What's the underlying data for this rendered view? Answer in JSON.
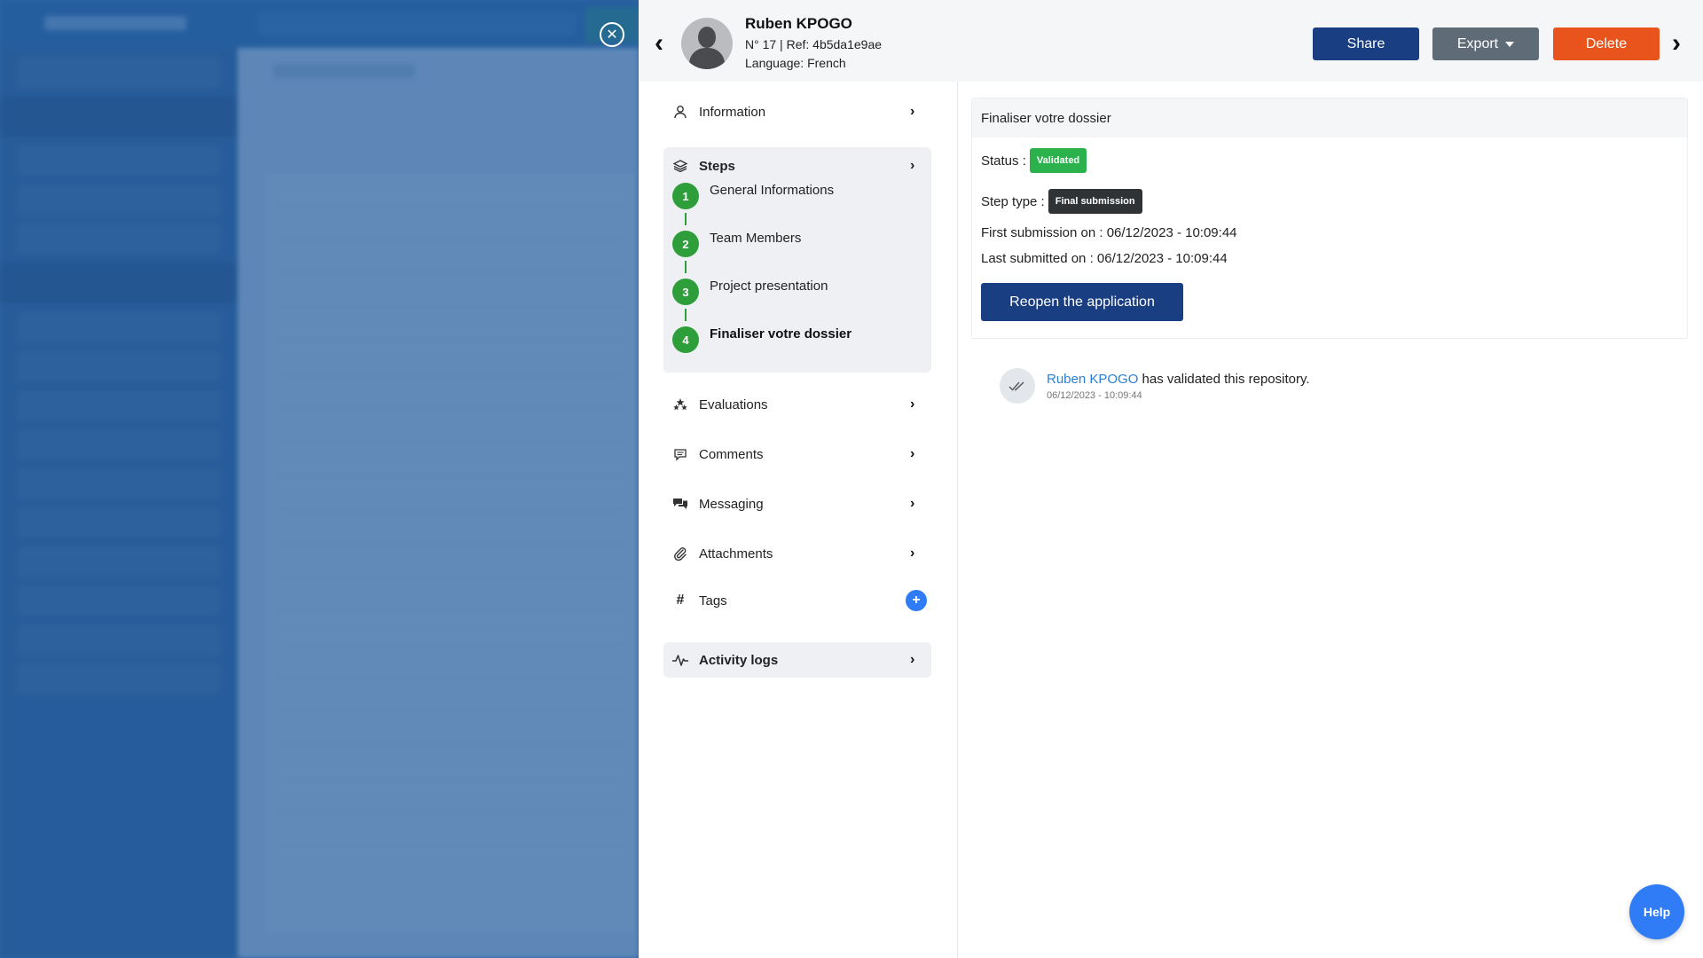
{
  "header": {
    "name": "Ruben KPOGO",
    "ref": "N° 17 | Ref: 4b5da1e9ae",
    "language": "Language: French",
    "share_label": "Share",
    "export_label": "Export",
    "delete_label": "Delete"
  },
  "menu": {
    "information": "Information",
    "steps": "Steps",
    "evaluations": "Evaluations",
    "comments": "Comments",
    "messaging": "Messaging",
    "attachments": "Attachments",
    "tags": "Tags",
    "activity_logs": "Activity logs"
  },
  "steps": [
    {
      "num": "1",
      "label": "General Informations"
    },
    {
      "num": "2",
      "label": "Team Members"
    },
    {
      "num": "3",
      "label": "Project presentation"
    },
    {
      "num": "4",
      "label": "Finaliser votre dossier"
    }
  ],
  "detail": {
    "title": "Finaliser votre dossier",
    "status_label": "Status :",
    "status_value": "Validated",
    "step_type_label": "Step type :",
    "step_type_value": "Final submission",
    "first_submission": "First submission on : 06/12/2023 - 10:09:44",
    "last_submitted": "Last submitted on : 06/12/2023 - 10:09:44",
    "reopen_label": "Reopen the application"
  },
  "activity": {
    "user": "Ruben KPOGO",
    "action": " has validated this repository.",
    "time": "06/12/2023 - 10:09:44"
  },
  "help_label": "Help",
  "colors": {
    "primary": "#1a3e82",
    "danger": "#e8541b",
    "secondary": "#5f6c78",
    "success": "#2e9e3b",
    "accent": "#2f7cf6"
  }
}
